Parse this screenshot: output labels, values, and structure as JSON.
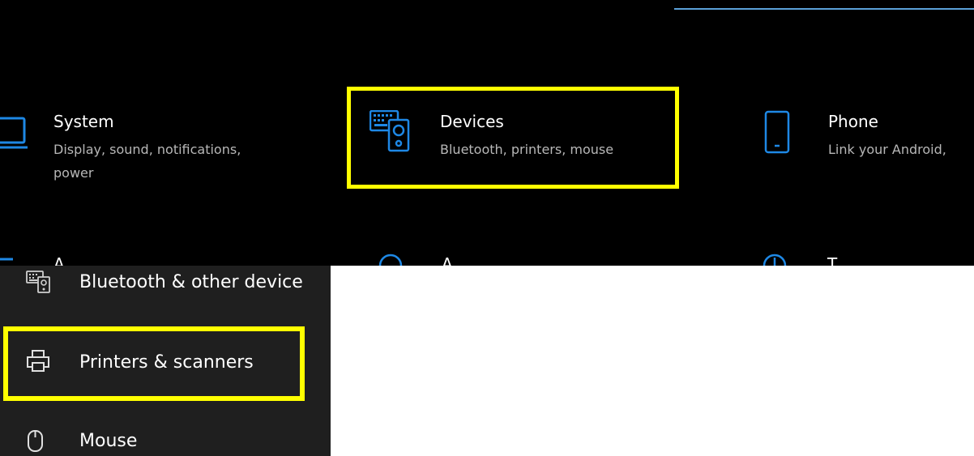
{
  "settings_grid": {
    "tiles": [
      {
        "id": "system",
        "title": "System",
        "subtitle_lines": [
          "Display, sound, notifications,",
          "power"
        ],
        "icon": "laptop-icon"
      },
      {
        "id": "devices",
        "title": "Devices",
        "subtitle_lines": [
          "Bluetooth, printers, mouse"
        ],
        "icon": "devices-icon"
      },
      {
        "id": "phone",
        "title": "Phone",
        "subtitle_lines": [
          "Link your Android, "
        ],
        "icon": "phone-icon"
      }
    ],
    "peek_row": [
      {
        "text": "A"
      },
      {
        "text": "A"
      },
      {
        "text": "T"
      }
    ]
  },
  "sidebar": {
    "items": [
      {
        "label": "Bluetooth & other device",
        "icon": "bluetooth-devices-icon"
      },
      {
        "label": "Printers & scanners",
        "icon": "printer-icon"
      },
      {
        "label": "Mouse",
        "icon": "mouse-icon"
      }
    ]
  },
  "colors": {
    "accent": "#1e88e5",
    "highlight": "#ffff00",
    "top_background": "#000000",
    "sidebar_background": "#1f1f1f"
  }
}
